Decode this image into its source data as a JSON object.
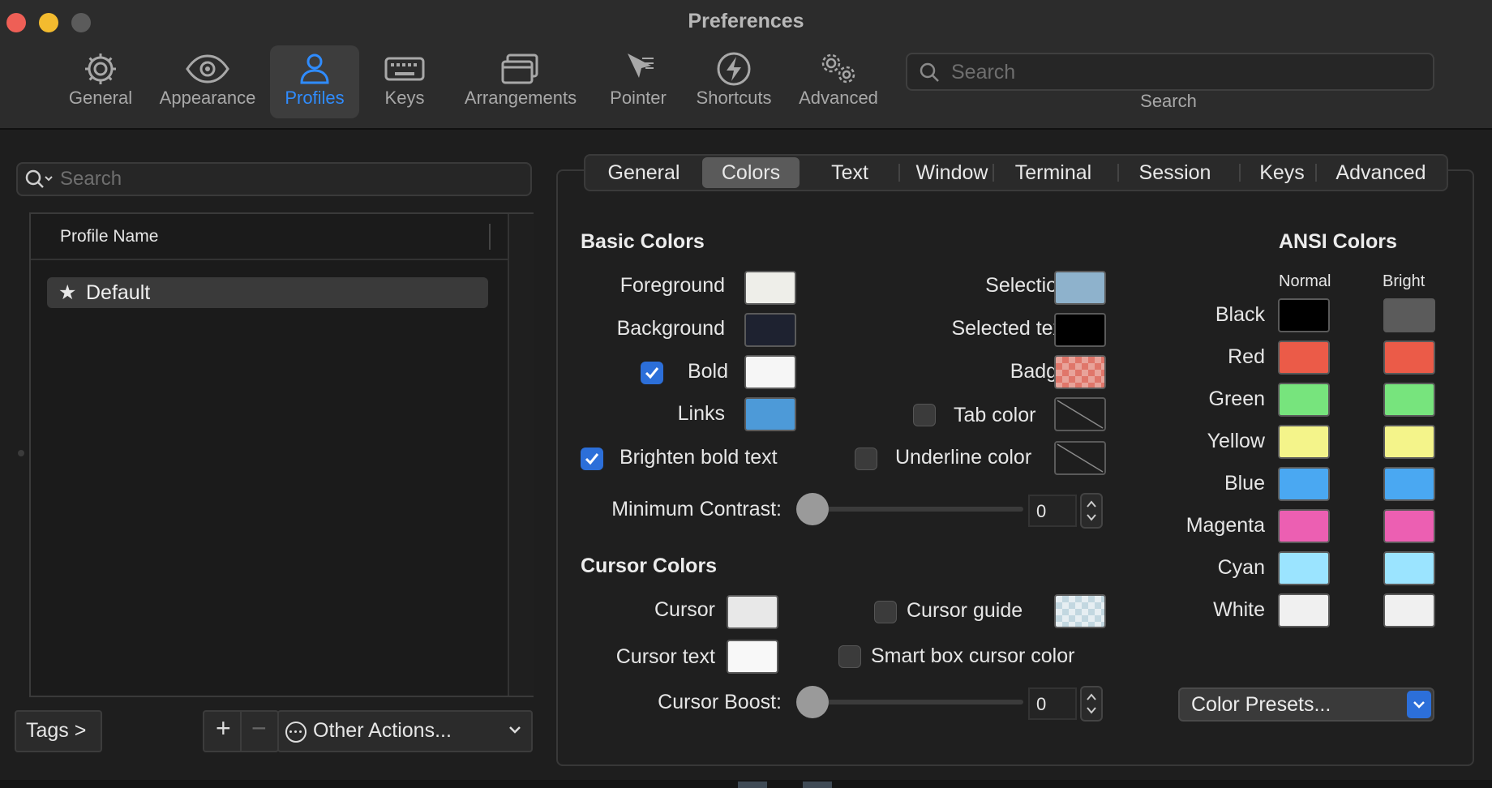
{
  "window": {
    "title": "Preferences"
  },
  "toolbar": {
    "items": [
      {
        "label": "General",
        "icon": "gear-icon"
      },
      {
        "label": "Appearance",
        "icon": "eye-icon"
      },
      {
        "label": "Profiles",
        "icon": "person-icon",
        "selected": true
      },
      {
        "label": "Keys",
        "icon": "keyboard-icon"
      },
      {
        "label": "Arrangements",
        "icon": "windows-icon"
      },
      {
        "label": "Pointer",
        "icon": "pointer-icon"
      },
      {
        "label": "Shortcuts",
        "icon": "lightning-icon"
      },
      {
        "label": "Advanced",
        "icon": "gears-icon"
      }
    ],
    "search": {
      "placeholder": "Search",
      "label": "Search"
    }
  },
  "profiles": {
    "search_placeholder": "Search",
    "column_header": "Profile Name",
    "items": [
      {
        "name": "Default",
        "star": "★"
      }
    ],
    "tags_button": "Tags >",
    "add_symbol": "+",
    "remove_symbol": "−",
    "other_actions": "Other Actions..."
  },
  "tabs": [
    "General",
    "Colors",
    "Text",
    "Window",
    "Terminal",
    "Session",
    "Keys",
    "Advanced"
  ],
  "selected_tab": "Colors",
  "basic_colors": {
    "title": "Basic Colors",
    "foreground": {
      "label": "Foreground",
      "color": "#eeeee9"
    },
    "background": {
      "label": "Background",
      "color": "#1e2230"
    },
    "bold": {
      "label": "Bold",
      "color": "#f6f6f6",
      "checked": true
    },
    "links": {
      "label": "Links",
      "color": "#4d9ad8"
    },
    "selection": {
      "label": "Selection",
      "color": "#8eb2cc"
    },
    "selected_text": {
      "label": "Selected text",
      "color": "#000000"
    },
    "badge": {
      "label": "Badge",
      "color": "#e8837a"
    },
    "tab_color": {
      "label": "Tab color",
      "checked": false
    },
    "underline_color": {
      "label": "Underline color",
      "checked": false
    },
    "brighten_bold": {
      "label": "Brighten bold text",
      "checked": true
    },
    "min_contrast": {
      "label": "Minimum Contrast:",
      "value": "0"
    }
  },
  "cursor_colors": {
    "title": "Cursor Colors",
    "cursor": {
      "label": "Cursor",
      "color": "#e8e8e8"
    },
    "cursor_text": {
      "label": "Cursor text",
      "color": "#f8f8f8"
    },
    "cursor_guide": {
      "label": "Cursor guide",
      "checked": false
    },
    "smart_box": {
      "label": "Smart box cursor color",
      "checked": false
    },
    "boost": {
      "label": "Cursor Boost:",
      "value": "0"
    }
  },
  "ansi": {
    "title": "ANSI Colors",
    "normal_header": "Normal",
    "bright_header": "Bright",
    "rows": [
      {
        "name": "Black",
        "normal": "#000000",
        "bright": "#5b5b5b"
      },
      {
        "name": "Red",
        "normal": "#eb5b48",
        "bright": "#eb5b48"
      },
      {
        "name": "Green",
        "normal": "#77e47d",
        "bright": "#77e47d"
      },
      {
        "name": "Yellow",
        "normal": "#f4f48a",
        "bright": "#f4f48a"
      },
      {
        "name": "Blue",
        "normal": "#4aa8f2",
        "bright": "#4aa8f2"
      },
      {
        "name": "Magenta",
        "normal": "#ec5fb2",
        "bright": "#ec5fb2"
      },
      {
        "name": "Cyan",
        "normal": "#9be4ff",
        "bright": "#9be4ff"
      },
      {
        "name": "White",
        "normal": "#f0f0f0",
        "bright": "#f0f0f0"
      }
    ],
    "presets_label": "Color Presets..."
  },
  "accent_color": "#2f8cff"
}
